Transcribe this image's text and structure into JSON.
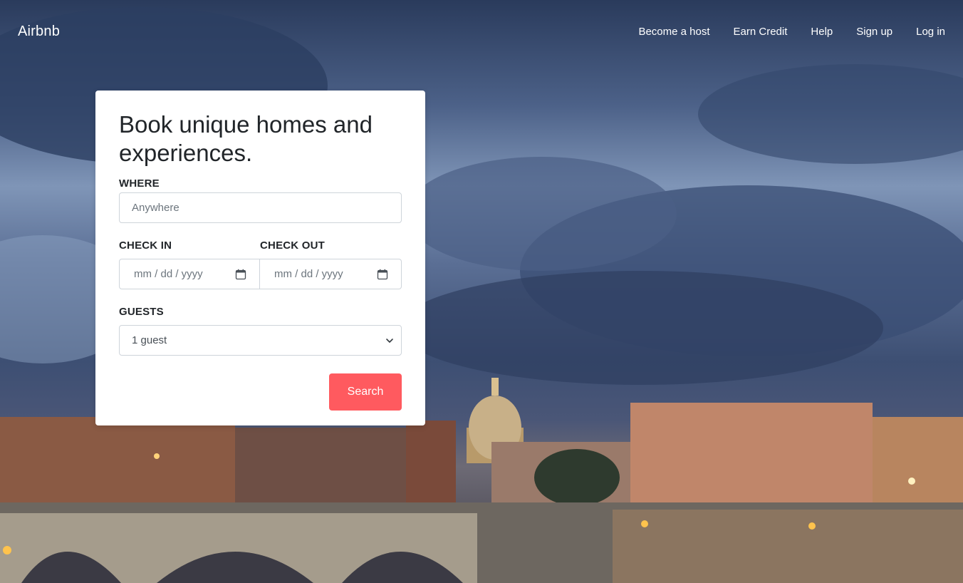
{
  "brand": "Airbnb",
  "nav": {
    "items": [
      {
        "label": "Become a host"
      },
      {
        "label": "Earn Credit"
      },
      {
        "label": "Help"
      },
      {
        "label": "Sign up"
      },
      {
        "label": "Log in"
      }
    ]
  },
  "booking": {
    "title": "Book unique homes and experiences.",
    "where": {
      "label": "WHERE",
      "placeholder": "Anywhere",
      "value": ""
    },
    "check_in": {
      "label": "CHECK IN",
      "placeholder": "mm / dd / yyyy",
      "icon": "calendar-icon"
    },
    "check_out": {
      "label": "CHECK OUT",
      "placeholder": "mm / dd / yyyy",
      "icon": "calendar-icon"
    },
    "guests": {
      "label": "GUESTS",
      "selected": "1 guest",
      "icon": "chevron-down-icon"
    },
    "search_label": "Search"
  },
  "colors": {
    "accent": "#ff5a5f",
    "card_bg": "#ffffff",
    "text": "#212529"
  }
}
